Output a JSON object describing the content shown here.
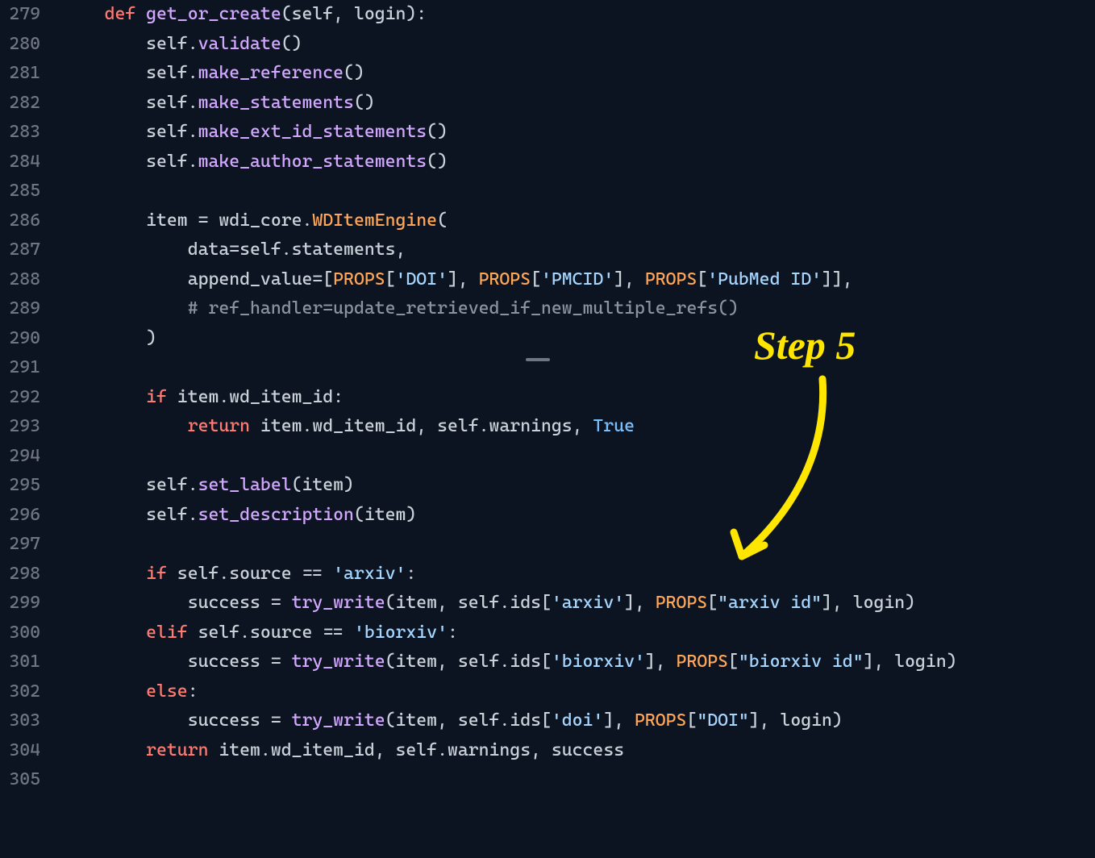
{
  "annotation_label": "Step 5",
  "lines": [
    {
      "n": "279",
      "tokens": [
        [
          "    ",
          ""
        ],
        [
          "def",
          "kw"
        ],
        [
          " ",
          ""
        ],
        [
          "get_or_create",
          "fn"
        ],
        [
          "(",
          ""
        ],
        [
          "self",
          "id"
        ],
        [
          ", ",
          ""
        ],
        [
          "login",
          "id"
        ],
        [
          "):",
          ""
        ]
      ]
    },
    {
      "n": "280",
      "tokens": [
        [
          "        ",
          ""
        ],
        [
          "self",
          "id"
        ],
        [
          ".",
          ""
        ],
        [
          "validate",
          "fn"
        ],
        [
          "()",
          ""
        ]
      ]
    },
    {
      "n": "281",
      "tokens": [
        [
          "        ",
          ""
        ],
        [
          "self",
          "id"
        ],
        [
          ".",
          ""
        ],
        [
          "make_reference",
          "fn"
        ],
        [
          "()",
          ""
        ]
      ]
    },
    {
      "n": "282",
      "tokens": [
        [
          "        ",
          ""
        ],
        [
          "self",
          "id"
        ],
        [
          ".",
          ""
        ],
        [
          "make_statements",
          "fn"
        ],
        [
          "()",
          ""
        ]
      ]
    },
    {
      "n": "283",
      "tokens": [
        [
          "        ",
          ""
        ],
        [
          "self",
          "id"
        ],
        [
          ".",
          ""
        ],
        [
          "make_ext_id_statements",
          "fn"
        ],
        [
          "()",
          ""
        ]
      ]
    },
    {
      "n": "284",
      "tokens": [
        [
          "        ",
          ""
        ],
        [
          "self",
          "id"
        ],
        [
          ".",
          ""
        ],
        [
          "make_author_statements",
          "fn"
        ],
        [
          "()",
          ""
        ]
      ]
    },
    {
      "n": "285",
      "tokens": []
    },
    {
      "n": "286",
      "tokens": [
        [
          "        ",
          ""
        ],
        [
          "item ",
          "id"
        ],
        [
          "= ",
          ""
        ],
        [
          "wdi_core",
          "id"
        ],
        [
          ".",
          ""
        ],
        [
          "WDItemEngine",
          "fnc"
        ],
        [
          "(",
          ""
        ]
      ]
    },
    {
      "n": "287",
      "tokens": [
        [
          "            ",
          ""
        ],
        [
          "data",
          "id"
        ],
        [
          "=",
          ""
        ],
        [
          "self",
          "id"
        ],
        [
          ".",
          ""
        ],
        [
          "statements",
          "id"
        ],
        [
          ",",
          ""
        ]
      ]
    },
    {
      "n": "288",
      "tokens": [
        [
          "            ",
          ""
        ],
        [
          "append_value",
          "id"
        ],
        [
          "=[",
          ""
        ],
        [
          "PROPS",
          "prop"
        ],
        [
          "[",
          ""
        ],
        [
          "'DOI'",
          "str"
        ],
        [
          "], ",
          ""
        ],
        [
          "PROPS",
          "prop"
        ],
        [
          "[",
          ""
        ],
        [
          "'PMCID'",
          "str"
        ],
        [
          "], ",
          ""
        ],
        [
          "PROPS",
          "prop"
        ],
        [
          "[",
          ""
        ],
        [
          "'PubMed ID'",
          "str"
        ],
        [
          "]],",
          ""
        ]
      ]
    },
    {
      "n": "289",
      "tokens": [
        [
          "            ",
          ""
        ],
        [
          "# ref_handler=update_retrieved_if_new_multiple_refs()",
          "com"
        ]
      ]
    },
    {
      "n": "290",
      "tokens": [
        [
          "        )",
          ""
        ]
      ]
    },
    {
      "n": "291",
      "tokens": []
    },
    {
      "n": "292",
      "tokens": [
        [
          "        ",
          ""
        ],
        [
          "if",
          "kw"
        ],
        [
          " ",
          ""
        ],
        [
          "item",
          "id"
        ],
        [
          ".",
          ""
        ],
        [
          "wd_item_id",
          "id"
        ],
        [
          ":",
          ""
        ]
      ]
    },
    {
      "n": "293",
      "tokens": [
        [
          "            ",
          ""
        ],
        [
          "return",
          "kw"
        ],
        [
          " ",
          ""
        ],
        [
          "item",
          "id"
        ],
        [
          ".",
          ""
        ],
        [
          "wd_item_id",
          "id"
        ],
        [
          ", ",
          ""
        ],
        [
          "self",
          "id"
        ],
        [
          ".",
          ""
        ],
        [
          "warnings",
          "id"
        ],
        [
          ", ",
          ""
        ],
        [
          "True",
          "const"
        ]
      ]
    },
    {
      "n": "294",
      "tokens": []
    },
    {
      "n": "295",
      "tokens": [
        [
          "        ",
          ""
        ],
        [
          "self",
          "id"
        ],
        [
          ".",
          ""
        ],
        [
          "set_label",
          "fn"
        ],
        [
          "(",
          ""
        ],
        [
          "item",
          "id"
        ],
        [
          ")",
          ""
        ]
      ]
    },
    {
      "n": "296",
      "tokens": [
        [
          "        ",
          ""
        ],
        [
          "self",
          "id"
        ],
        [
          ".",
          ""
        ],
        [
          "set_description",
          "fn"
        ],
        [
          "(",
          ""
        ],
        [
          "item",
          "id"
        ],
        [
          ")",
          ""
        ]
      ]
    },
    {
      "n": "297",
      "tokens": []
    },
    {
      "n": "298",
      "tokens": [
        [
          "        ",
          ""
        ],
        [
          "if",
          "kw"
        ],
        [
          " ",
          ""
        ],
        [
          "self",
          "id"
        ],
        [
          ".",
          ""
        ],
        [
          "source ",
          "id"
        ],
        [
          "== ",
          ""
        ],
        [
          "'arxiv'",
          "str"
        ],
        [
          ":",
          ""
        ]
      ]
    },
    {
      "n": "299",
      "tokens": [
        [
          "            ",
          ""
        ],
        [
          "success ",
          "id"
        ],
        [
          "= ",
          ""
        ],
        [
          "try_write",
          "fn"
        ],
        [
          "(",
          ""
        ],
        [
          "item",
          "id"
        ],
        [
          ", ",
          ""
        ],
        [
          "self",
          "id"
        ],
        [
          ".",
          ""
        ],
        [
          "ids",
          "id"
        ],
        [
          "[",
          ""
        ],
        [
          "'arxiv'",
          "str"
        ],
        [
          "], ",
          ""
        ],
        [
          "PROPS",
          "prop"
        ],
        [
          "[",
          ""
        ],
        [
          "\"arxiv id\"",
          "str"
        ],
        [
          "], ",
          ""
        ],
        [
          "login",
          "id"
        ],
        [
          ")",
          ""
        ]
      ]
    },
    {
      "n": "300",
      "tokens": [
        [
          "        ",
          ""
        ],
        [
          "elif",
          "kw"
        ],
        [
          " ",
          ""
        ],
        [
          "self",
          "id"
        ],
        [
          ".",
          ""
        ],
        [
          "source ",
          "id"
        ],
        [
          "== ",
          ""
        ],
        [
          "'biorxiv'",
          "str"
        ],
        [
          ":",
          ""
        ]
      ]
    },
    {
      "n": "301",
      "tokens": [
        [
          "            ",
          ""
        ],
        [
          "success ",
          "id"
        ],
        [
          "= ",
          ""
        ],
        [
          "try_write",
          "fn"
        ],
        [
          "(",
          ""
        ],
        [
          "item",
          "id"
        ],
        [
          ", ",
          ""
        ],
        [
          "self",
          "id"
        ],
        [
          ".",
          ""
        ],
        [
          "ids",
          "id"
        ],
        [
          "[",
          ""
        ],
        [
          "'biorxiv'",
          "str"
        ],
        [
          "], ",
          ""
        ],
        [
          "PROPS",
          "prop"
        ],
        [
          "[",
          ""
        ],
        [
          "\"biorxiv id\"",
          "str"
        ],
        [
          "], ",
          ""
        ],
        [
          "login",
          "id"
        ],
        [
          ")",
          ""
        ]
      ]
    },
    {
      "n": "302",
      "tokens": [
        [
          "        ",
          ""
        ],
        [
          "else",
          "kw"
        ],
        [
          ":",
          ""
        ]
      ]
    },
    {
      "n": "303",
      "tokens": [
        [
          "            ",
          ""
        ],
        [
          "success ",
          "id"
        ],
        [
          "= ",
          ""
        ],
        [
          "try_write",
          "fn"
        ],
        [
          "(",
          ""
        ],
        [
          "item",
          "id"
        ],
        [
          ", ",
          ""
        ],
        [
          "self",
          "id"
        ],
        [
          ".",
          ""
        ],
        [
          "ids",
          "id"
        ],
        [
          "[",
          ""
        ],
        [
          "'doi'",
          "str"
        ],
        [
          "], ",
          ""
        ],
        [
          "PROPS",
          "prop"
        ],
        [
          "[",
          ""
        ],
        [
          "\"DOI\"",
          "str"
        ],
        [
          "], ",
          ""
        ],
        [
          "login",
          "id"
        ],
        [
          ")",
          ""
        ]
      ]
    },
    {
      "n": "304",
      "tokens": [
        [
          "        ",
          ""
        ],
        [
          "return",
          "kw"
        ],
        [
          " ",
          ""
        ],
        [
          "item",
          "id"
        ],
        [
          ".",
          ""
        ],
        [
          "wd_item_id",
          "id"
        ],
        [
          ", ",
          ""
        ],
        [
          "self",
          "id"
        ],
        [
          ".",
          ""
        ],
        [
          "warnings",
          "id"
        ],
        [
          ", ",
          ""
        ],
        [
          "success",
          "id"
        ]
      ]
    },
    {
      "n": "305",
      "tokens": []
    }
  ]
}
